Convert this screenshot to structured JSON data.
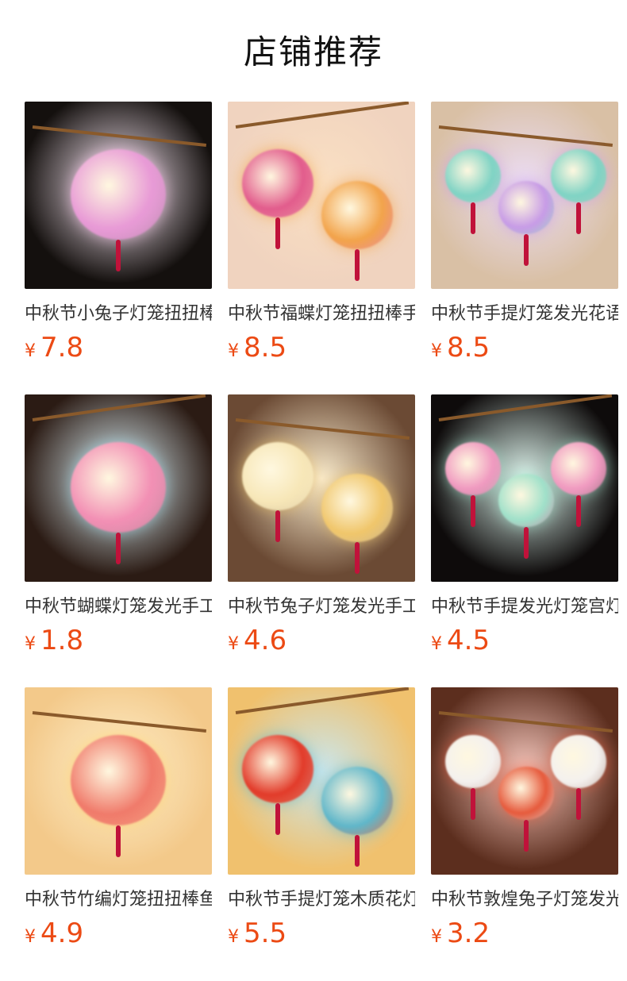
{
  "section_title": "店铺推荐",
  "currency_symbol": "¥",
  "products": [
    {
      "name": "中秋节小兔子灯笼扭扭棒手工diy材料包",
      "price": "7.8",
      "icon": "rabbit-lantern-image",
      "bg": "#14100e",
      "accent": "#e89ad6",
      "accent2": "#f6c7e8"
    },
    {
      "name": "中秋节福蝶灯笼扭扭棒手工diy材料包",
      "price": "8.5",
      "icon": "butterfly-lantern-image",
      "bg": "#f0d3bf",
      "accent": "#e25c8c",
      "accent2": "#f2a34a"
    },
    {
      "name": "中秋节手提灯笼发光花语亭宫灯",
      "price": "8.5",
      "icon": "pavilion-lantern-image",
      "bg": "#d9c0a5",
      "accent": "#7fd3c4",
      "accent2": "#c79be6"
    },
    {
      "name": "中秋节蝴蝶灯笼发光手工diy材料包",
      "price": "1.8",
      "icon": "butterfly-kite-lantern-image",
      "bg": "#2b1b14",
      "accent": "#f28fb4",
      "accent2": "#9fd6e6"
    },
    {
      "name": "中秋节兔子灯笼发光手工diy材料包",
      "price": "4.6",
      "icon": "rabbit-moon-lantern-image",
      "bg": "#6b4a34",
      "accent": "#f7e7b8",
      "accent2": "#f0c66b"
    },
    {
      "name": "中秋节手提发光灯笼宫灯diy材料包",
      "price": "4.5",
      "icon": "palace-lantern-image",
      "bg": "#0e0b0b",
      "accent": "#f09ac0",
      "accent2": "#9fe0c9"
    },
    {
      "name": "中秋节竹编灯笼扭扭棒鱼灯diy材料包",
      "price": "4.9",
      "icon": "fish-lantern-image",
      "bg": "#f3c98a",
      "accent": "#f07a6a",
      "accent2": "#ffd36a"
    },
    {
      "name": "中秋节手提灯笼木质花灯diy材料包",
      "price": "5.5",
      "icon": "wooden-flower-lantern-image",
      "bg": "#f0c16e",
      "accent": "#e23b2a",
      "accent2": "#5fb6c9"
    },
    {
      "name": "中秋节敦煌兔子灯笼发光diy材料包",
      "price": "3.2",
      "icon": "dunhuang-rabbit-lantern-image",
      "bg": "#5c2e1e",
      "accent": "#f4f1ee",
      "accent2": "#e65a3c"
    }
  ]
}
